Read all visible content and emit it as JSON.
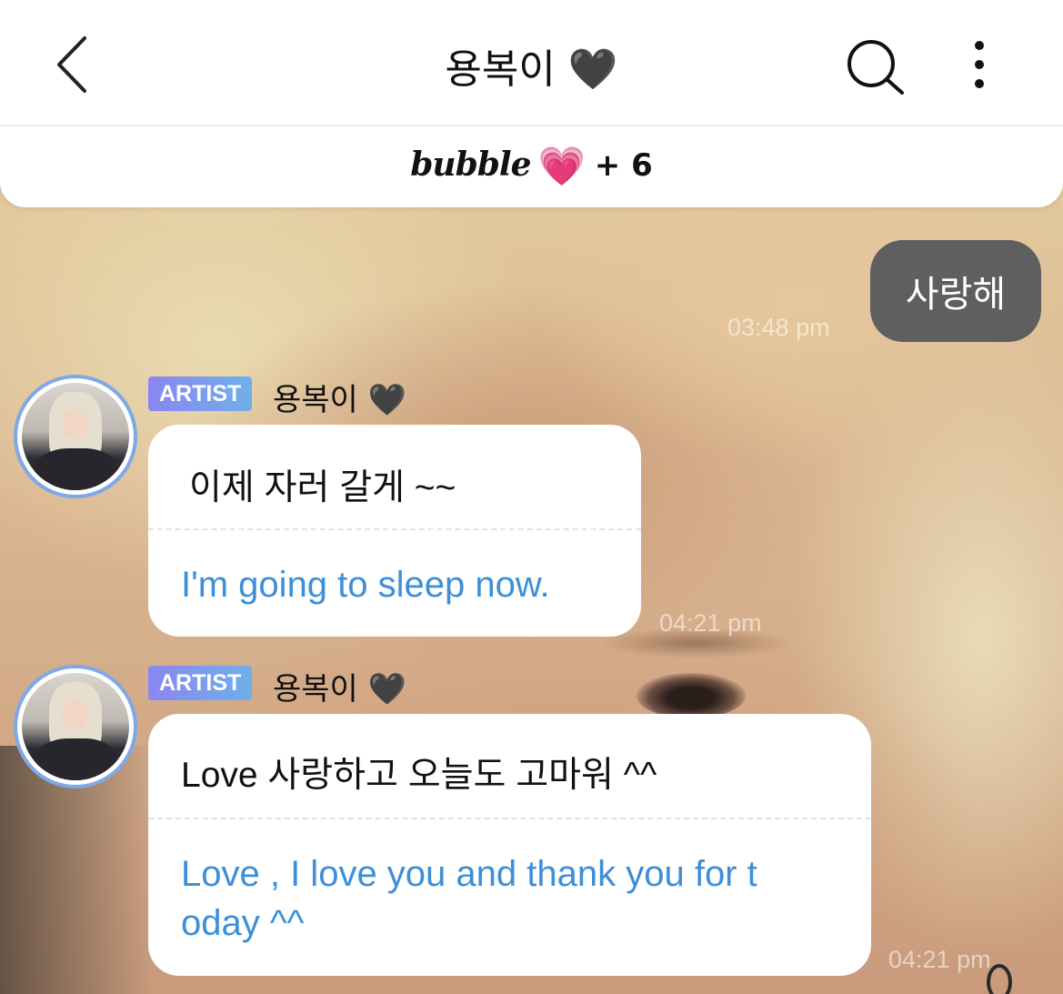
{
  "header": {
    "title": "용복이 🖤",
    "back_icon": "chevron-left-icon",
    "search_icon": "search-icon",
    "more_icon": "more-vertical-icon"
  },
  "subbar": {
    "logo": "bubble",
    "heart": "💗",
    "plus": "+ 6"
  },
  "my_message": {
    "text": "사랑해",
    "time": "03:48 pm"
  },
  "messages": [
    {
      "badge": "ARTIST",
      "sender": "용복이 🖤",
      "original": "이제 자러 갈게 ~~",
      "translation": "I'm going to sleep now.",
      "time": "04:21 pm"
    },
    {
      "badge": "ARTIST",
      "sender": "용복이 🖤",
      "original": "Love  사랑하고 오늘도 고마워 ^^",
      "translation_line1": "Love , I love you and thank you for t",
      "translation_line2": "oday ^^",
      "time": "04:21 pm"
    }
  ],
  "colors": {
    "badge_start": "#8a86f0",
    "badge_end": "#6fb0ea",
    "translation": "#3d8fd8",
    "my_bubble": "#5f5f5f",
    "avatar_ring": "#7fa8e6",
    "pink_heart": "#e4559a"
  }
}
